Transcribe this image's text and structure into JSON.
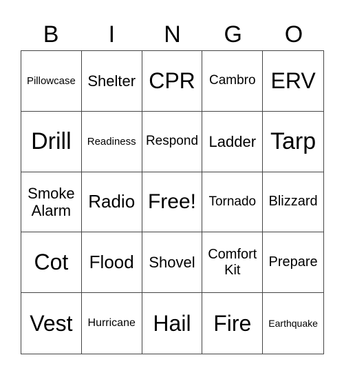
{
  "header": [
    "B",
    "I",
    "N",
    "G",
    "O"
  ],
  "cells": [
    "Pillowcase",
    "Shelter",
    "CPR",
    "Cambro",
    "ERV",
    "Drill",
    "Readiness",
    "Respond",
    "Ladder",
    "Tarp",
    "Smoke Alarm",
    "Radio",
    "Free!",
    "Tornado",
    "Blizzard",
    "Cot",
    "Flood",
    "Shovel",
    "Comfort Kit",
    "Prepare",
    "Vest",
    "Hurricane",
    "Hail",
    "Fire",
    "Earthquake"
  ]
}
